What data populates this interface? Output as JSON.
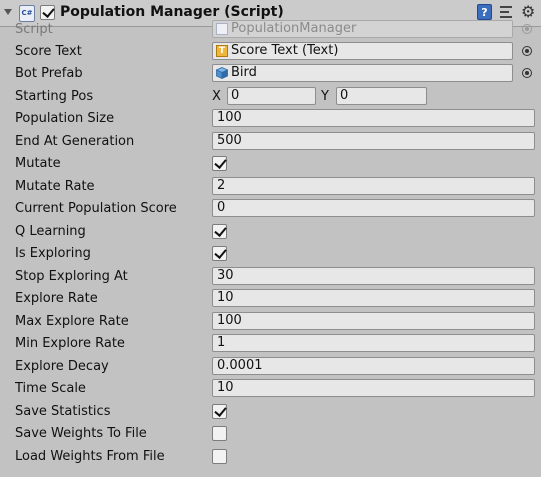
{
  "component": {
    "title": "Population Manager (Script)",
    "enabled": true,
    "script_icon_text": "C#"
  },
  "fields": {
    "script": {
      "label": "Script",
      "value": "PopulationManager"
    },
    "score_text": {
      "label": "Score Text",
      "value": "Score Text (Text)",
      "icon_letter": "T"
    },
    "bot_prefab": {
      "label": "Bot Prefab",
      "value": "Bird"
    },
    "starting_pos": {
      "label": "Starting Pos",
      "x_label": "X",
      "x": "0",
      "y_label": "Y",
      "y": "0"
    },
    "population_size": {
      "label": "Population Size",
      "value": "100"
    },
    "end_at_generation": {
      "label": "End At Generation",
      "value": "500"
    },
    "mutate": {
      "label": "Mutate",
      "checked": true
    },
    "mutate_rate": {
      "label": "Mutate Rate",
      "value": "2"
    },
    "current_population_score": {
      "label": "Current Population Score",
      "value": "0"
    },
    "q_learning": {
      "label": "Q Learning",
      "checked": true
    },
    "is_exploring": {
      "label": "Is Exploring",
      "checked": true
    },
    "stop_exploring_at": {
      "label": "Stop Exploring At",
      "value": "30"
    },
    "explore_rate": {
      "label": "Explore Rate",
      "value": "10"
    },
    "max_explore_rate": {
      "label": "Max Explore Rate",
      "value": "100"
    },
    "min_explore_rate": {
      "label": "Min Explore Rate",
      "value": "1"
    },
    "explore_decay": {
      "label": "Explore Decay",
      "value": "0.0001"
    },
    "time_scale": {
      "label": "Time Scale",
      "value": "10"
    },
    "save_statistics": {
      "label": "Save Statistics",
      "checked": true
    },
    "save_weights_to_file": {
      "label": "Save Weights To File",
      "checked": false
    },
    "load_weights_from_file": {
      "label": "Load Weights From File",
      "checked": false
    }
  },
  "icons": {
    "help": "?",
    "gear": "⚙"
  }
}
